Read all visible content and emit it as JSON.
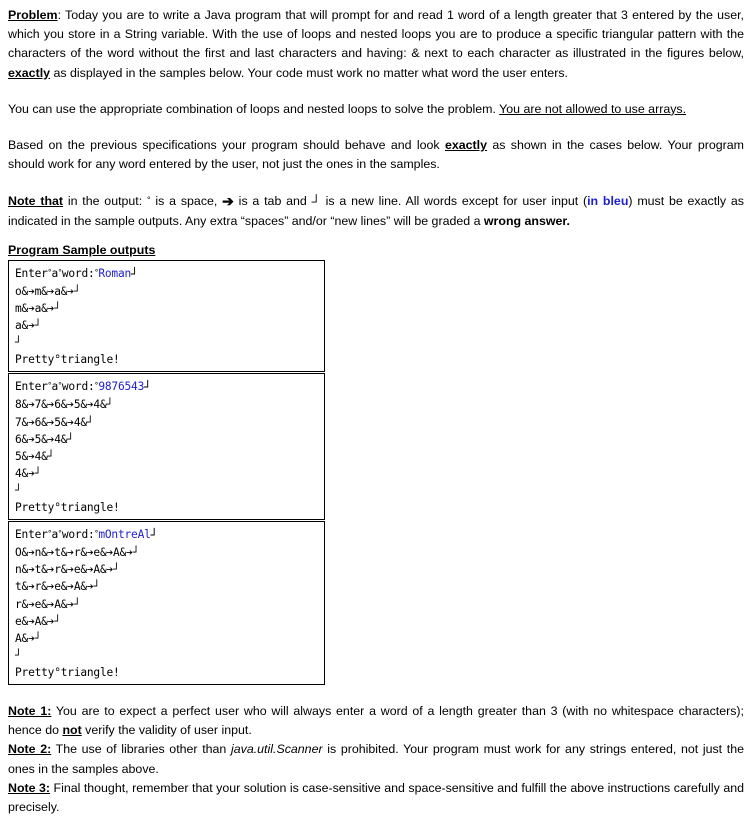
{
  "document": {
    "intro": {
      "label": "Problem",
      "text": ": Today you are to write a Java program that will prompt for and read 1 word of a length greater that 3 entered by the user, which you store in a String variable. With the use of loops and nested loops you are to produce a specific triangular pattern with the characters of the word without the first and last characters and having: & next to each character as illustrated in the figures below, ",
      "emphasis": "exactly",
      "text_after": " as displayed in the samples below. Your code must work no matter what word the user enters."
    },
    "arrays_rule": {
      "text_before": "You can use the appropriate combination of loops and nested loops to solve the problem. ",
      "underlined": "You are not allowed to use arrays."
    },
    "behavior": {
      "text_before": "Based on the previous specifications your program should behave and look ",
      "emphasis": "exactly",
      "text_after": " as shown in the cases below. Your program should work for any word entered by the user, not just the ones in the samples."
    },
    "note_that": {
      "label": "Note that",
      "seg1": " in the output: ",
      "sym_space": "°",
      "seg2": " is a space, ",
      "sym_tab": "➔",
      "seg3": " is a tab and ",
      "sym_newline": "┘",
      "seg4": " is a new line. All words except for user input (",
      "blue_label": "in bleu",
      "seg5": ") must be exactly as indicated in the sample outputs. Any extra “spaces” and/or “new lines” will be graded a ",
      "bold_end": "wrong answer."
    },
    "samples_heading": "Program Sample outputs",
    "samples": [
      {
        "prompt_prefix": "Enter",
        "prompt_word1": "a",
        "prompt_word2": "word:",
        "input_value": "Roman",
        "lines": [
          "o&➔m&➔a&➔┘",
          "m&➔a&➔┘",
          "a&➔┘",
          "┘",
          "Pretty°triangle!"
        ]
      },
      {
        "prompt_prefix": "Enter",
        "prompt_word1": "a",
        "prompt_word2": "word:",
        "input_value": "9876543",
        "lines": [
          "8&➔7&➔6&➔5&➔4&┘",
          "7&➔6&➔5&➔4&┘",
          "6&➔5&➔4&┘",
          "5&➔4&┘",
          "4&➔┘",
          "┘",
          "Pretty°triangle!"
        ]
      },
      {
        "prompt_prefix": "Enter",
        "prompt_word1": "a",
        "prompt_word2": "word:",
        "input_value": "mOntreAl",
        "lines": [
          "O&➔n&➔t&➔r&➔e&➔A&➔┘",
          "n&➔t&➔r&➔e&➔A&➔┘",
          "t&➔r&➔e&➔A&➔┘",
          "r&➔e&➔A&➔┘",
          "e&➔A&➔┘",
          "A&➔┘",
          "┘",
          "Pretty°triangle!"
        ]
      }
    ],
    "notes": [
      {
        "label": "Note 1:",
        "text_before": " You are to expect a perfect user who will always enter a word of a length greater than 3 (with no whitespace characters); hence do ",
        "emphasis": "not",
        "text_after": " verify the validity of user input."
      },
      {
        "label": "Note 2:",
        "text_before": " The use of libraries other than ",
        "italic": "java.util.Scanner",
        "text_after": " is prohibited. Your program must work for any strings entered, not just the ones in the samples above."
      },
      {
        "label": "Note 3:",
        "text_before": " Final thought, remember that your solution is case-sensitive and space-sensitive and fulfill the above instructions carefully and precisely.",
        "emphasis": "",
        "text_after": ""
      }
    ]
  }
}
